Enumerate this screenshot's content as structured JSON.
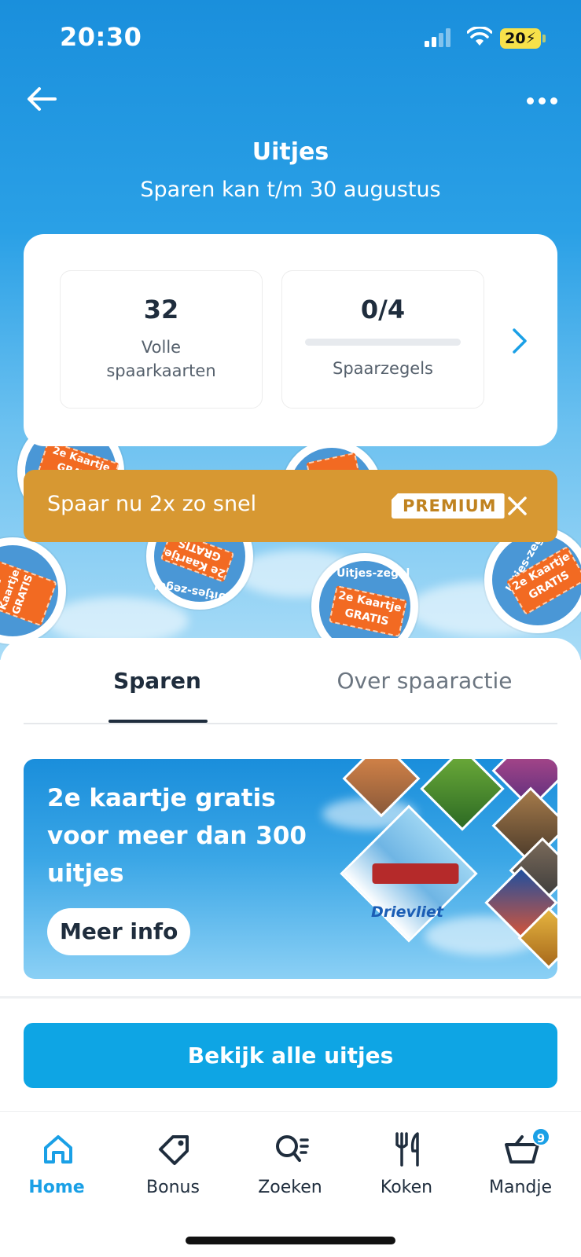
{
  "status_bar": {
    "time": "20:30",
    "battery": "20"
  },
  "header": {
    "title": "Uitjes",
    "subtitle": "Sparen kan t/m 30 augustus"
  },
  "stats": {
    "full_cards_value": "32",
    "full_cards_label_line1": "Volle",
    "full_cards_label_line2": "spaarkaarten",
    "stamps_value": "0/4",
    "stamps_label": "Spaarzegels",
    "stamps_progress_fraction": 0
  },
  "badge_text": {
    "ring": "Uitjes-zegel",
    "ticket_line1": "2e Kaartje",
    "ticket_line2": "GRATIS"
  },
  "premium_banner": {
    "text": "Spaar nu 2x zo snel",
    "badge": "PREMIUM"
  },
  "tabs": [
    {
      "label": "Sparen",
      "active": true
    },
    {
      "label": "Over spaaractie",
      "active": false
    }
  ],
  "promo": {
    "title": "2e kaartje gratis voor meer dan 300 uitjes",
    "button_label": "Meer info",
    "tile_label": "Drievliet"
  },
  "cta": {
    "label": "Bekijk alle uitjes"
  },
  "bottom_nav": [
    {
      "label": "Home",
      "icon": "home-icon",
      "active": true
    },
    {
      "label": "Bonus",
      "icon": "tag-icon",
      "active": false
    },
    {
      "label": "Zoeken",
      "icon": "search-icon",
      "active": false
    },
    {
      "label": "Koken",
      "icon": "cutlery-icon",
      "active": false
    },
    {
      "label": "Mandje",
      "icon": "basket-icon",
      "active": false
    }
  ],
  "cart_count": "9",
  "colors": {
    "brand_blue": "#1aa0e6",
    "premium_gold": "#d79832",
    "ticket_orange": "#f26a22"
  }
}
